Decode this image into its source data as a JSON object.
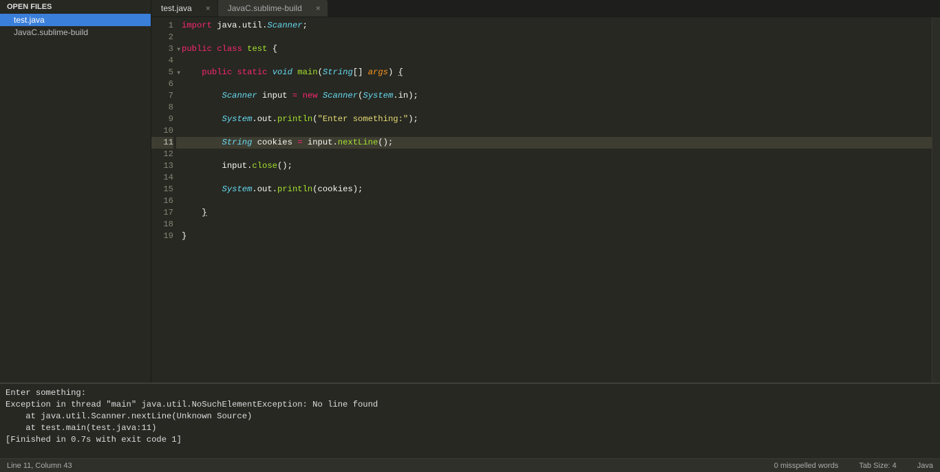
{
  "sidebar": {
    "header": "OPEN FILES",
    "items": [
      {
        "label": "test.java",
        "active": true
      },
      {
        "label": "JavaC.sublime-build",
        "active": false
      }
    ]
  },
  "tabs": [
    {
      "label": "test.java",
      "active": true
    },
    {
      "label": "JavaC.sublime-build",
      "active": false
    }
  ],
  "code": {
    "lines": [
      {
        "n": 1,
        "tokens": [
          [
            "kw-red",
            "import"
          ],
          [
            "kw-white",
            " "
          ],
          [
            "kw-white",
            "java"
          ],
          [
            "kw-white",
            "."
          ],
          [
            "kw-white",
            "util"
          ],
          [
            "kw-white",
            "."
          ],
          [
            "kw-blue",
            "Scanner"
          ],
          [
            "kw-white",
            ";"
          ]
        ]
      },
      {
        "n": 2,
        "tokens": []
      },
      {
        "n": 3,
        "fold": true,
        "tokens": [
          [
            "kw-red",
            "public"
          ],
          [
            "kw-white",
            " "
          ],
          [
            "kw-red",
            "class"
          ],
          [
            "kw-white",
            " "
          ],
          [
            "kw-green",
            "test"
          ],
          [
            "kw-white",
            " {"
          ]
        ]
      },
      {
        "n": 4,
        "tokens": []
      },
      {
        "n": 5,
        "fold": true,
        "dot": true,
        "tokens": [
          [
            "kw-white",
            "    "
          ],
          [
            "kw-red",
            "public"
          ],
          [
            "kw-white",
            " "
          ],
          [
            "kw-red",
            "static"
          ],
          [
            "kw-white",
            " "
          ],
          [
            "kw-blue",
            "void"
          ],
          [
            "kw-white",
            " "
          ],
          [
            "kw-green",
            "main"
          ],
          [
            "kw-white",
            "("
          ],
          [
            "kw-blue",
            "String"
          ],
          [
            "kw-white",
            "[] "
          ],
          [
            "kw-orange",
            "args"
          ],
          [
            "kw-white",
            ") "
          ],
          [
            "bracket-hl",
            "{"
          ]
        ]
      },
      {
        "n": 6,
        "tokens": []
      },
      {
        "n": 7,
        "tokens": [
          [
            "kw-white",
            "        "
          ],
          [
            "kw-blue",
            "Scanner"
          ],
          [
            "kw-white",
            " input "
          ],
          [
            "kw-red",
            "="
          ],
          [
            "kw-white",
            " "
          ],
          [
            "kw-red",
            "new"
          ],
          [
            "kw-white",
            " "
          ],
          [
            "kw-blue",
            "Scanner"
          ],
          [
            "kw-white",
            "("
          ],
          [
            "kw-blue",
            "System"
          ],
          [
            "kw-white",
            "."
          ],
          [
            "kw-white",
            "in);"
          ]
        ]
      },
      {
        "n": 8,
        "tokens": []
      },
      {
        "n": 9,
        "tokens": [
          [
            "kw-white",
            "        "
          ],
          [
            "kw-blue",
            "System"
          ],
          [
            "kw-white",
            "."
          ],
          [
            "kw-white",
            "out"
          ],
          [
            "kw-white",
            "."
          ],
          [
            "kw-green",
            "println"
          ],
          [
            "kw-white",
            "("
          ],
          [
            "kw-yellow",
            "\"Enter something:\""
          ],
          [
            "kw-white",
            ");"
          ]
        ]
      },
      {
        "n": 10,
        "tokens": []
      },
      {
        "n": 11,
        "current": true,
        "tokens": [
          [
            "kw-white",
            "        "
          ],
          [
            "kw-blue",
            "String"
          ],
          [
            "kw-white",
            " cookies "
          ],
          [
            "kw-red",
            "="
          ],
          [
            "kw-white",
            " input"
          ],
          [
            "kw-white",
            "."
          ],
          [
            "kw-green",
            "nextLine"
          ],
          [
            "kw-white",
            "();"
          ]
        ]
      },
      {
        "n": 12,
        "tokens": []
      },
      {
        "n": 13,
        "tokens": [
          [
            "kw-white",
            "        input"
          ],
          [
            "kw-white",
            "."
          ],
          [
            "kw-green",
            "close"
          ],
          [
            "kw-white",
            "();"
          ]
        ]
      },
      {
        "n": 14,
        "tokens": []
      },
      {
        "n": 15,
        "tokens": [
          [
            "kw-white",
            "        "
          ],
          [
            "kw-blue",
            "System"
          ],
          [
            "kw-white",
            "."
          ],
          [
            "kw-white",
            "out"
          ],
          [
            "kw-white",
            "."
          ],
          [
            "kw-green",
            "println"
          ],
          [
            "kw-white",
            "(cookies);"
          ]
        ]
      },
      {
        "n": 16,
        "tokens": []
      },
      {
        "n": 17,
        "dot": true,
        "tokens": [
          [
            "kw-white",
            "    "
          ],
          [
            "bracket-hl",
            "}"
          ]
        ]
      },
      {
        "n": 18,
        "tokens": []
      },
      {
        "n": 19,
        "tokens": [
          [
            "kw-white",
            "}"
          ]
        ]
      }
    ]
  },
  "console_lines": [
    "Enter something:",
    "Exception in thread \"main\" java.util.NoSuchElementException: No line found",
    "    at java.util.Scanner.nextLine(Unknown Source)",
    "    at test.main(test.java:11)",
    "[Finished in 0.7s with exit code 1]"
  ],
  "statusbar": {
    "left": "Line 11, Column 43",
    "spell": "0 misspelled words",
    "tabsize": "Tab Size: 4",
    "lang": "Java"
  }
}
